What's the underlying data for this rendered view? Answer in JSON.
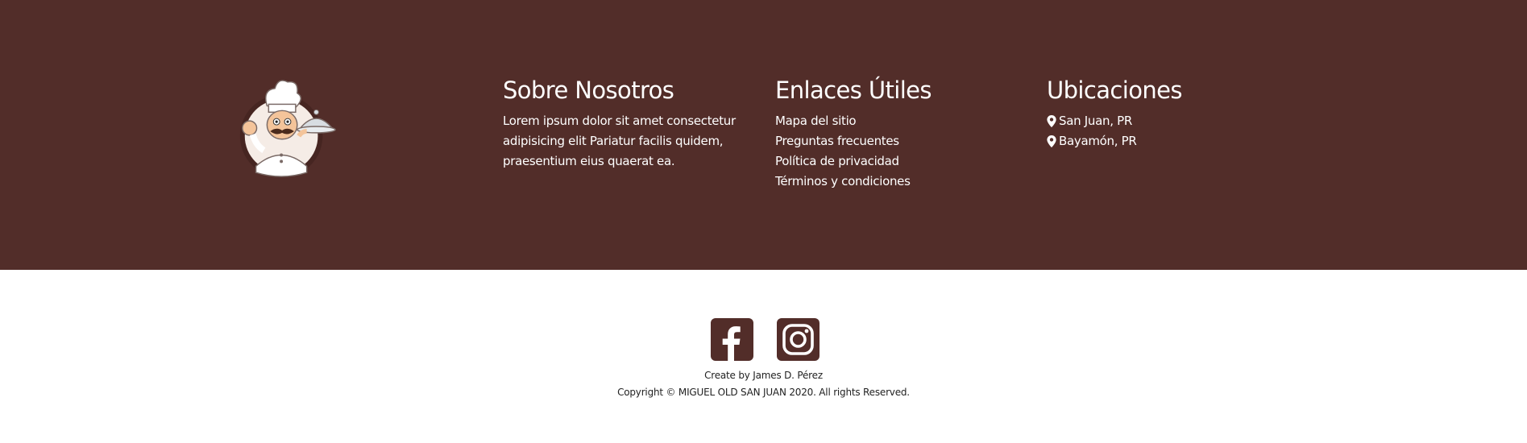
{
  "logo": {
    "icon": "chef-logo-icon"
  },
  "about": {
    "title": "Sobre Nosotros",
    "text": "Lorem ipsum dolor sit amet consectetur adipisicing elit Pariatur facilis quidem, praesentium eius quaerat ea."
  },
  "links": {
    "title": "Enlaces Útiles",
    "items": [
      {
        "label": "Mapa del sitio"
      },
      {
        "label": "Preguntas frecuentes"
      },
      {
        "label": "Política de privacidad"
      },
      {
        "label": "Términos y condiciones"
      }
    ]
  },
  "locations": {
    "title": "Ubicaciones",
    "icon": "map-pin-icon",
    "items": [
      {
        "label": "San Juan, PR"
      },
      {
        "label": "Bayamón, PR"
      }
    ]
  },
  "social": {
    "items": [
      {
        "icon": "facebook-icon"
      },
      {
        "icon": "instagram-icon"
      }
    ]
  },
  "credits": {
    "created_by": "Create by James D. Pérez",
    "copyright": "Copyright © MIGUEL OLD SAN JUAN 2020. All rights Reserved."
  },
  "colors": {
    "footer_bg": "#522d29",
    "text_light": "#ffffff",
    "social_icon": "#522d29"
  }
}
